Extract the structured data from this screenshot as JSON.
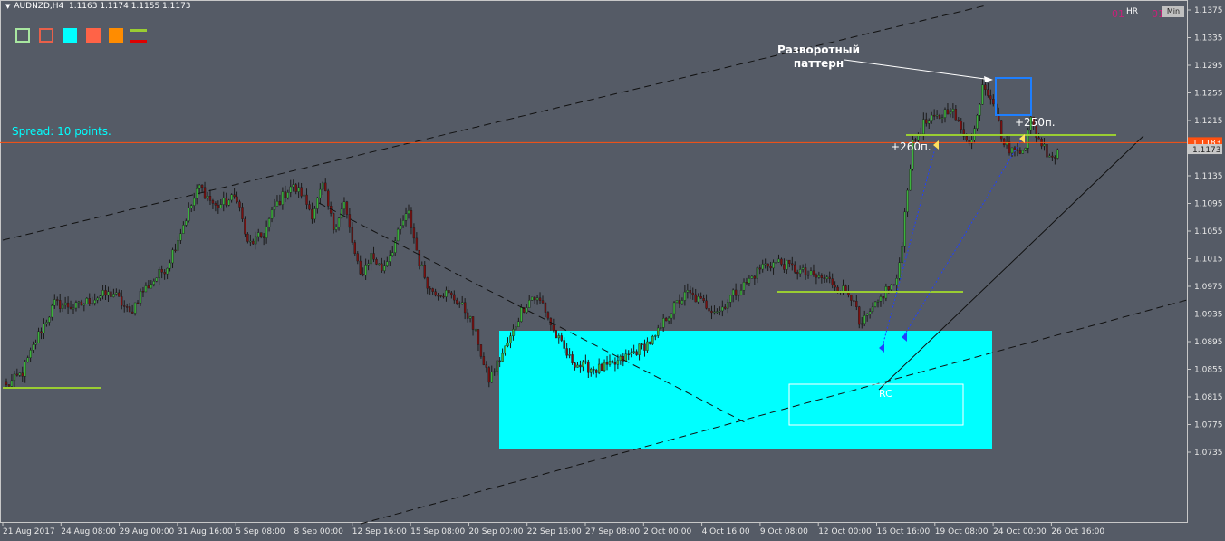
{
  "header": {
    "symbol": "AUDNZD,H4",
    "ohlc": "1.1163 1.1174 1.1155 1.1173"
  },
  "toolbar": {
    "colors": {
      "green_outline": "#a8e6a0",
      "red_outline": "#e8604a",
      "cyan": "#00ffff",
      "tomato": "#ff6347",
      "orange": "#ff8c00",
      "line_green": "#9acd32",
      "line_red": "#dd0000"
    },
    "icons": [
      "green-square-outline-icon",
      "red-square-outline-icon",
      "cyan-square-icon",
      "tomato-square-icon",
      "orange-square-icon",
      "line-style-icon"
    ]
  },
  "timeframe": {
    "left_num": "01",
    "label": "HR",
    "right_num": "01",
    "button": "Min"
  },
  "spread_label": "Spread: 10 points.",
  "annotation": {
    "line1": "Разворотный",
    "line2": "паттерн",
    "plus260": "+260п.",
    "plus250": "+250п.",
    "rc": "RC"
  },
  "price_tag_red": "1.1183",
  "price_tag_gray": "1.1173",
  "chart_data": {
    "type": "candlestick",
    "symbol": "AUDNZD",
    "timeframe": "H4",
    "ylim": [
      1.0735,
      1.1375
    ],
    "y_ticks": [
      "1.1375",
      "1.1335",
      "1.1295",
      "1.1255",
      "1.1215",
      "1.1175",
      "1.1135",
      "1.1095",
      "1.1055",
      "1.1015",
      "1.0975",
      "1.0935",
      "1.0895",
      "1.0855",
      "1.0815",
      "1.0775",
      "1.0735"
    ],
    "x_ticks": [
      "21 Aug 2017",
      "24 Aug 08:00",
      "29 Aug 00:00",
      "31 Aug 16:00",
      "5 Sep 08:00",
      "8 Sep 00:00",
      "12 Sep 16:00",
      "15 Sep 08:00",
      "20 Sep 00:00",
      "22 Sep 16:00",
      "27 Sep 08:00",
      "2 Oct 00:00",
      "4 Oct 16:00",
      "9 Oct 08:00",
      "12 Oct 00:00",
      "16 Oct 16:00",
      "19 Oct 08:00",
      "24 Oct 00:00",
      "26 Oct 16:00"
    ],
    "current_price": 1.1173,
    "red_line_price": 1.1183,
    "colors": {
      "background": "#555b66",
      "bull": "#3cb33c",
      "bear": "#7a1010",
      "zone": "#00ffff",
      "level": "#9acd32",
      "redline": "#ff5010"
    },
    "waypoints": [
      [
        0,
        1.083
      ],
      [
        6,
        1.085
      ],
      [
        12,
        1.0905
      ],
      [
        18,
        1.095
      ],
      [
        26,
        1.0945
      ],
      [
        34,
        1.096
      ],
      [
        40,
        1.0965
      ],
      [
        46,
        1.0935
      ],
      [
        50,
        1.0965
      ],
      [
        54,
        1.098
      ],
      [
        60,
        1.1005
      ],
      [
        66,
        1.1065
      ],
      [
        72,
        1.112
      ],
      [
        78,
        1.109
      ],
      [
        86,
        1.1105
      ],
      [
        90,
        1.1035
      ],
      [
        96,
        1.105
      ],
      [
        100,
        1.109
      ],
      [
        106,
        1.112
      ],
      [
        110,
        1.111
      ],
      [
        114,
        1.108
      ],
      [
        118,
        1.112
      ],
      [
        122,
        1.106
      ],
      [
        126,
        1.1095
      ],
      [
        130,
        1.102
      ],
      [
        132,
        1.099
      ],
      [
        136,
        1.102
      ],
      [
        140,
        1.1
      ],
      [
        144,
        1.103
      ],
      [
        148,
        1.107
      ],
      [
        150,
        1.108
      ],
      [
        154,
        1.101
      ],
      [
        158,
        1.097
      ],
      [
        164,
        1.0965
      ],
      [
        168,
        1.0955
      ],
      [
        172,
        1.0935
      ],
      [
        176,
        1.0895
      ],
      [
        178,
        1.086
      ],
      [
        180,
        1.084
      ],
      [
        184,
        1.087
      ],
      [
        188,
        1.09
      ],
      [
        192,
        1.094
      ],
      [
        196,
        1.096
      ],
      [
        200,
        1.095
      ],
      [
        204,
        1.091
      ],
      [
        210,
        1.087
      ],
      [
        214,
        1.086
      ],
      [
        220,
        1.0855
      ],
      [
        226,
        1.086
      ],
      [
        232,
        1.0875
      ],
      [
        238,
        1.089
      ],
      [
        242,
        1.09
      ],
      [
        246,
        1.093
      ],
      [
        250,
        1.095
      ],
      [
        254,
        1.0965
      ],
      [
        258,
        1.0955
      ],
      [
        262,
        1.0945
      ],
      [
        266,
        1.094
      ],
      [
        270,
        1.096
      ],
      [
        276,
        1.098
      ],
      [
        282,
        1.1005
      ],
      [
        288,
        1.101
      ],
      [
        294,
        1.1
      ],
      [
        300,
        1.099
      ],
      [
        306,
        1.0985
      ],
      [
        312,
        1.097
      ],
      [
        316,
        1.096
      ],
      [
        318,
        1.0915
      ],
      [
        320,
        1.0925
      ],
      [
        324,
        1.0945
      ],
      [
        328,
        1.097
      ],
      [
        332,
        1.098
      ],
      [
        334,
        1.104
      ],
      [
        336,
        1.112
      ],
      [
        338,
        1.118
      ],
      [
        342,
        1.121
      ],
      [
        348,
        1.122
      ],
      [
        352,
        1.1235
      ],
      [
        356,
        1.12
      ],
      [
        360,
        1.1185
      ],
      [
        362,
        1.122
      ],
      [
        364,
        1.127
      ],
      [
        368,
        1.1245
      ],
      [
        370,
        1.121
      ],
      [
        372,
        1.118
      ],
      [
        376,
        1.117
      ],
      [
        380,
        1.118
      ],
      [
        382,
        1.1215
      ],
      [
        384,
        1.1195
      ],
      [
        388,
        1.117
      ],
      [
        392,
        1.116
      ]
    ]
  }
}
